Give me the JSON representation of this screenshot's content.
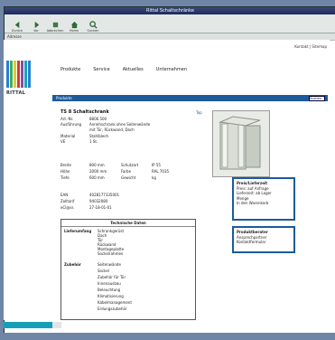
{
  "window": {
    "title": "Rittal Schaltschränke"
  },
  "toolbar": {
    "buttons": [
      {
        "label": "Zurück",
        "icon": "back-arrow-icon"
      },
      {
        "label": "Vor",
        "icon": "forward-arrow-icon"
      },
      {
        "label": "Abbrechen",
        "icon": "stop-icon"
      },
      {
        "label": "Home",
        "icon": "home-icon"
      },
      {
        "label": "Suchen",
        "icon": "search-icon"
      }
    ]
  },
  "address": {
    "label": "Adresse"
  },
  "page": {
    "top_links": "Kontakt | Sitemap",
    "logo_text": "RITTAL",
    "nav": [
      "Produkte",
      "Service",
      "Aktuelles",
      "Unternehmen"
    ],
    "breadcrumb": "Produkte",
    "search_label": "Suchen",
    "product": {
      "title": "TS 8 Schaltschrank",
      "top_link": "Top",
      "specs": [
        {
          "label": "Art.-Nr.",
          "value": "8806.500"
        },
        {
          "label": "Ausführung",
          "value": "Anreihschrank ohne Seitenwände"
        },
        {
          "label": "",
          "value": "mit Tür, Rückwand, Dach"
        },
        {
          "label": "Material",
          "value": "Stahlblech"
        },
        {
          "label": "VE",
          "value": "1 St."
        }
      ],
      "dimensions": [
        {
          "c1": "Breite",
          "c2": "800 mm",
          "c3": "Schutzart",
          "c4": "IP 55"
        },
        {
          "c1": "Höhe",
          "c2": "2000 mm",
          "c3": "Farbe",
          "c4": "RAL 7035"
        },
        {
          "c1": "Tiefe",
          "c2": "600 mm",
          "c3": "Gewicht",
          "c4": "kg"
        }
      ],
      "codes": [
        {
          "c1": "EAN",
          "c2": "4028177335001"
        },
        {
          "c1": "Zolltarif",
          "c2": "94032080"
        },
        {
          "c1": "eCl@ss",
          "c2": "27-18-01-01"
        }
      ],
      "box1": {
        "header": "Preis/Lieferzeit",
        "lines": [
          "Preis: auf Anfrage",
          "Lieferzeit: ab Lager",
          "Menge",
          "In den Warenkorb"
        ]
      },
      "box2": {
        "header": "Produktberater",
        "lines": [
          "Ansprechpartner",
          "Kontaktformular"
        ]
      },
      "detail": {
        "header": "Technische Daten",
        "sections": [
          {
            "label": "Lieferumfang",
            "lines": [
              "Schrankgerüst",
              "Dach",
              "Tür",
              "Rückwand",
              "Montageplatte",
              "Sockelrahmen"
            ]
          },
          {
            "label": "Zubehör",
            "lines": [
              "Seitenwände",
              "Sockel",
              "Zubehör für Tür",
              "Innenausbau",
              "Beleuchtung",
              "Klimatisierung",
              "Kabelmanagement",
              "Erdungszubehör"
            ]
          }
        ]
      }
    }
  },
  "colors": {
    "accent": "#1c5a9c",
    "desktop": "#6f86a6",
    "status": "#15a0b7"
  }
}
